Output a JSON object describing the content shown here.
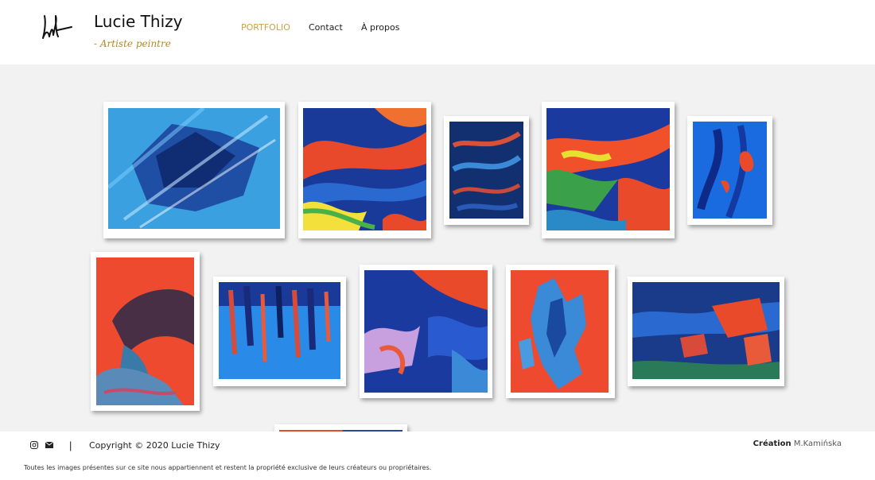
{
  "header": {
    "logo_alt": "Lucie Thizy signature",
    "title": "Lucie Thizy",
    "tagline": "- Artiste peintre"
  },
  "nav": {
    "items": [
      {
        "label": "PORTFOLIO",
        "active": true
      },
      {
        "label": "Contact",
        "active": false
      },
      {
        "label": "À propos",
        "active": false
      }
    ]
  },
  "gallery": {
    "paintings": [
      {
        "name": "abstract blue diagonal"
      },
      {
        "name": "blue red waves"
      },
      {
        "name": "dark blue red strokes"
      },
      {
        "name": "blue green red burst"
      },
      {
        "name": "blue figure red accent"
      },
      {
        "name": "figure on red background"
      },
      {
        "name": "blue red vertical drips"
      },
      {
        "name": "blue pink diagonal"
      },
      {
        "name": "blue shapes on red"
      },
      {
        "name": "dark blue red landscape"
      },
      {
        "name": "partial painting bottom"
      }
    ]
  },
  "footer": {
    "instagram_icon": "instagram-icon",
    "mail_icon": "mail-icon",
    "separator": "|",
    "copyright": "Copyright © 2020 Lucie Thizy",
    "creation_label": "Création",
    "creation_name": "M.Kamińska",
    "disclaimer": "Toutes les images présentes sur ce site nous appartiennent et restent la propriété exclusive de leurs créateurs ou propriétaires."
  },
  "colors": {
    "accent": "#c8a24a",
    "tagline": "#b08a2a",
    "background": "#f2f2f2"
  }
}
